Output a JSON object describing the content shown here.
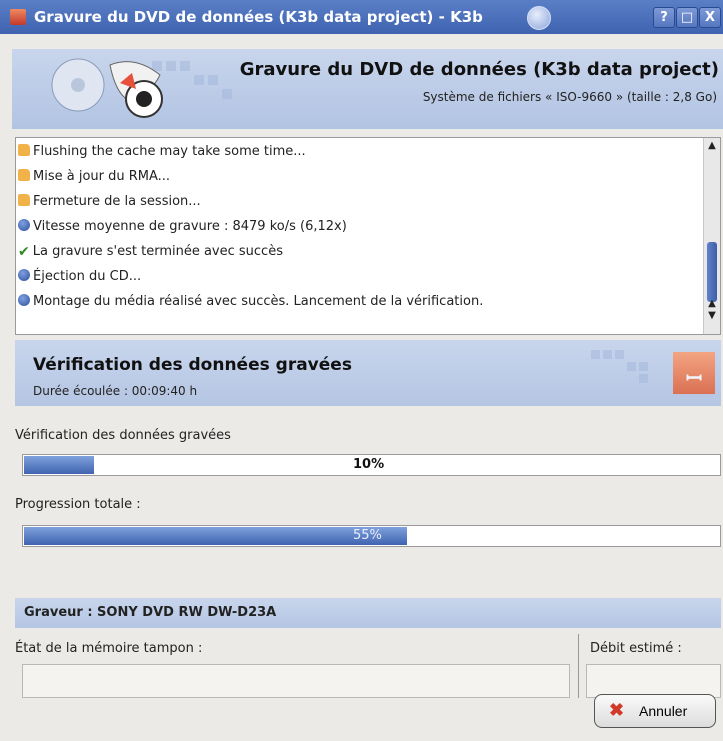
{
  "window": {
    "title": "Gravure du DVD de données (K3b data project) - K3b",
    "buttons": [
      "?",
      "□",
      "X"
    ]
  },
  "header": {
    "title": "Gravure du DVD de données (K3b data project)",
    "subtitle": "Système de fichiers « ISO-9660 » (taille : 2,8 Go)"
  },
  "log": {
    "items": [
      {
        "icon": "folder-icon",
        "text": "Flushing the cache may take some time..."
      },
      {
        "icon": "folder-icon",
        "text": "Mise à jour du RMA..."
      },
      {
        "icon": "folder-icon",
        "text": "Fermeture de la session..."
      },
      {
        "icon": "info-icon",
        "text": "Vitesse moyenne de gravure : 8479 ko/s (6,12x)"
      },
      {
        "icon": "check-icon",
        "text": "La gravure s'est terminée avec succès"
      },
      {
        "icon": "info-icon",
        "text": "Éjection du CD..."
      },
      {
        "icon": "info-icon",
        "text": "Montage du média réalisé avec succès. Lancement de la vérification."
      }
    ]
  },
  "verification": {
    "title": "Vérification des données gravées",
    "elapsed": "Durée écoulée : 00:09:40 h"
  },
  "progress": {
    "task_label": "Vérification des données gravées",
    "task_percent": 10,
    "task_percent_text": "10%",
    "total_label": "Progression totale :",
    "total_percent": 55,
    "total_percent_text": "55%"
  },
  "burner": {
    "label": "Graveur : SONY DVD RW DW-D23A",
    "buffer_label": "État de la mémoire tampon :",
    "buffer_value": "",
    "rate_label": "Débit estimé :"
  },
  "actions": {
    "cancel_label": "Annuler"
  },
  "colors": {
    "titlebar": "#4a6fbd",
    "panel": "#c0cfe9",
    "progress": "#3f63b0"
  }
}
